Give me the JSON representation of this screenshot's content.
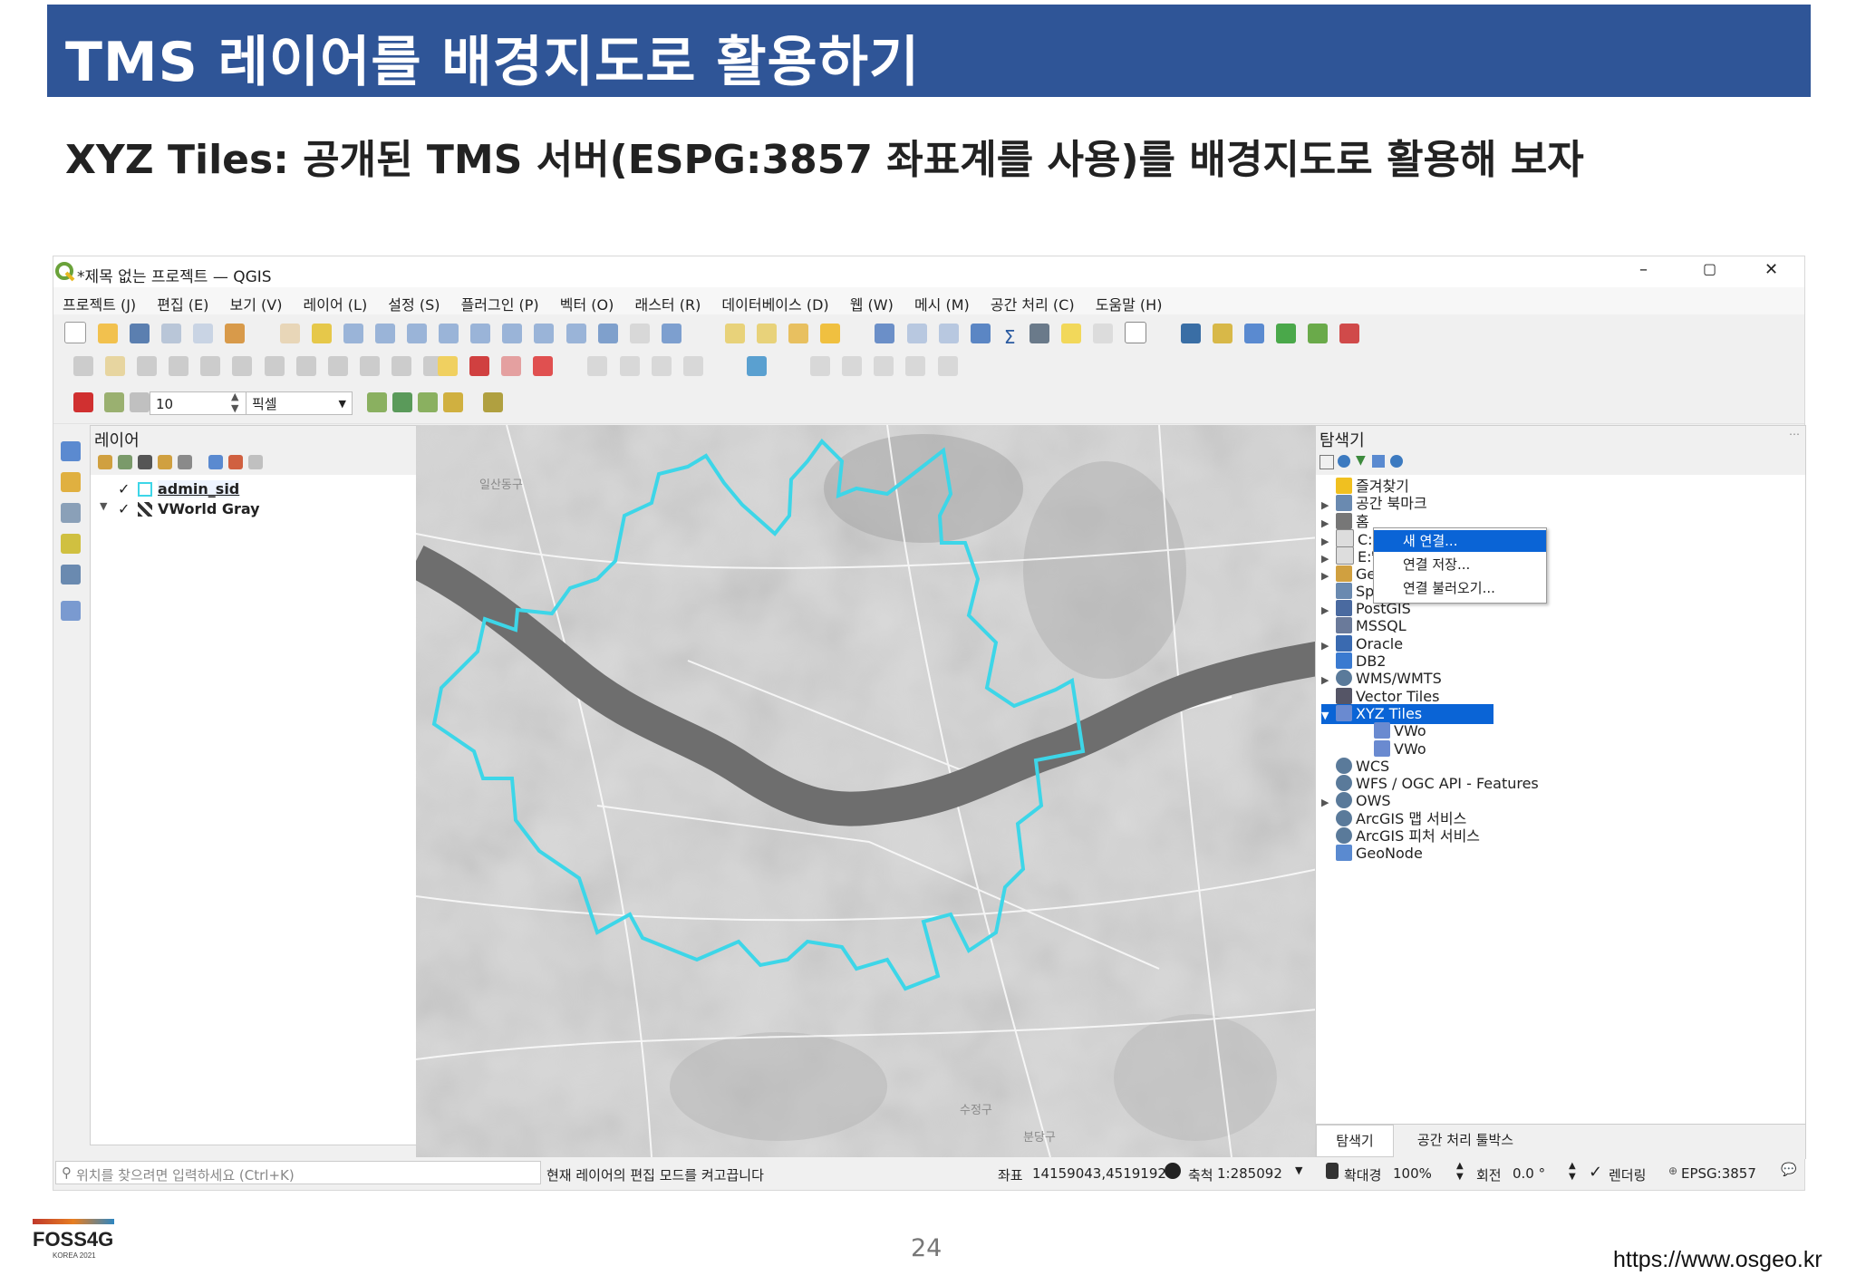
{
  "slide": {
    "title": "TMS 레이어를 배경지도로 활용하기",
    "subtitle": "XYZ Tiles: 공개된 TMS 서버(ESPG:3857 좌표계를 사용)를 배경지도로 활용해 보자",
    "page_number": "24",
    "footer_url": "https://www.osgeo.kr",
    "logo_text": "FOSS4G",
    "logo_subtext": "KOREA 2021"
  },
  "window": {
    "title": "*제목 없는 프로젝트 — QGIS",
    "controls": [
      "–",
      "▢",
      "✕"
    ]
  },
  "menu": [
    "프로젝트 (J)",
    "편집 (E)",
    "보기 (V)",
    "레이어 (L)",
    "설정 (S)",
    "플러그인 (P)",
    "벡터 (O)",
    "래스터 (R)",
    "데이터베이스 (D)",
    "웹 (W)",
    "메시 (M)",
    "공간 처리 (C)",
    "도움말 (H)"
  ],
  "snapping": {
    "value": "10",
    "unit": "픽셀"
  },
  "layers_panel": {
    "title": "레이어",
    "layers": [
      {
        "name": "admin_sid",
        "checked": true
      },
      {
        "name": "VWorld Gray",
        "checked": true
      }
    ]
  },
  "map_labels": [
    "일산동구",
    "수정구",
    "분당구"
  ],
  "browser_panel": {
    "title": "탐색기",
    "items": [
      {
        "label": "즐겨찾기",
        "icon": "star-icon",
        "expandable": false
      },
      {
        "label": "공간 북마크",
        "icon": "bookmark-icon",
        "expandable": true
      },
      {
        "label": "홈",
        "icon": "home-icon",
        "expandable": true
      },
      {
        "label": "C:₩",
        "icon": "folder-icon",
        "expandable": true
      },
      {
        "label": "E:₩",
        "icon": "folder-icon",
        "expandable": true
      },
      {
        "label": "GeoPackage",
        "icon": "geopackage-icon",
        "expandable": true
      },
      {
        "label": "SpatiaLite",
        "icon": "spatialite-icon",
        "expandable": false
      },
      {
        "label": "PostGIS",
        "icon": "postgis-icon",
        "expandable": true
      },
      {
        "label": "MSSQL",
        "icon": "mssql-icon",
        "expandable": false
      },
      {
        "label": "Oracle",
        "icon": "oracle-icon",
        "expandable": true
      },
      {
        "label": "DB2",
        "icon": "db2-icon",
        "expandable": false
      },
      {
        "label": "WMS/WMTS",
        "icon": "globe-icon",
        "expandable": true
      },
      {
        "label": "Vector Tiles",
        "icon": "grid-icon",
        "expandable": false
      },
      {
        "label": "XYZ Tiles",
        "icon": "tiles-icon",
        "expandable": true,
        "selected": true
      },
      {
        "label": "VWo",
        "icon": "tiles-icon",
        "child": true
      },
      {
        "label": "VWo",
        "icon": "tiles-icon",
        "child": true
      },
      {
        "label": "WCS",
        "icon": "globe-icon",
        "expandable": false
      },
      {
        "label": "WFS / OGC API - Features",
        "icon": "globe-icon",
        "expandable": false
      },
      {
        "label": "OWS",
        "icon": "globe-icon",
        "expandable": true
      },
      {
        "label": "ArcGIS 맵 서비스",
        "icon": "arcgis-icon",
        "expandable": false
      },
      {
        "label": "ArcGIS 피처 서비스",
        "icon": "arcgis-icon",
        "expandable": false
      },
      {
        "label": "GeoNode",
        "icon": "geonode-icon",
        "expandable": false
      }
    ],
    "tabs": [
      "탐색기",
      "공간 처리 툴박스"
    ]
  },
  "context_menu": [
    "새 연결...",
    "연결 저장...",
    "연결 불러오기..."
  ],
  "status": {
    "search_placeholder": "위치를 찾으려면 입력하세요 (Ctrl+K)",
    "message": "현재 레이어의 편집 모드를 켜고끕니다",
    "coord_label": "좌표",
    "coord_value": "14159043,4519192",
    "scale_label": "축척",
    "scale_value": "1:285092",
    "magnifier_label": "확대경",
    "magnifier_value": "100%",
    "rotation_label": "회전",
    "rotation_value": "0.0 °",
    "render_label": "렌더링",
    "crs": "EPSG:3857"
  },
  "colors": {
    "title_bar": "#2f5597",
    "boundary": "#3dd6e8",
    "river": "#6e6e6e",
    "selection": "#0a64d6"
  }
}
